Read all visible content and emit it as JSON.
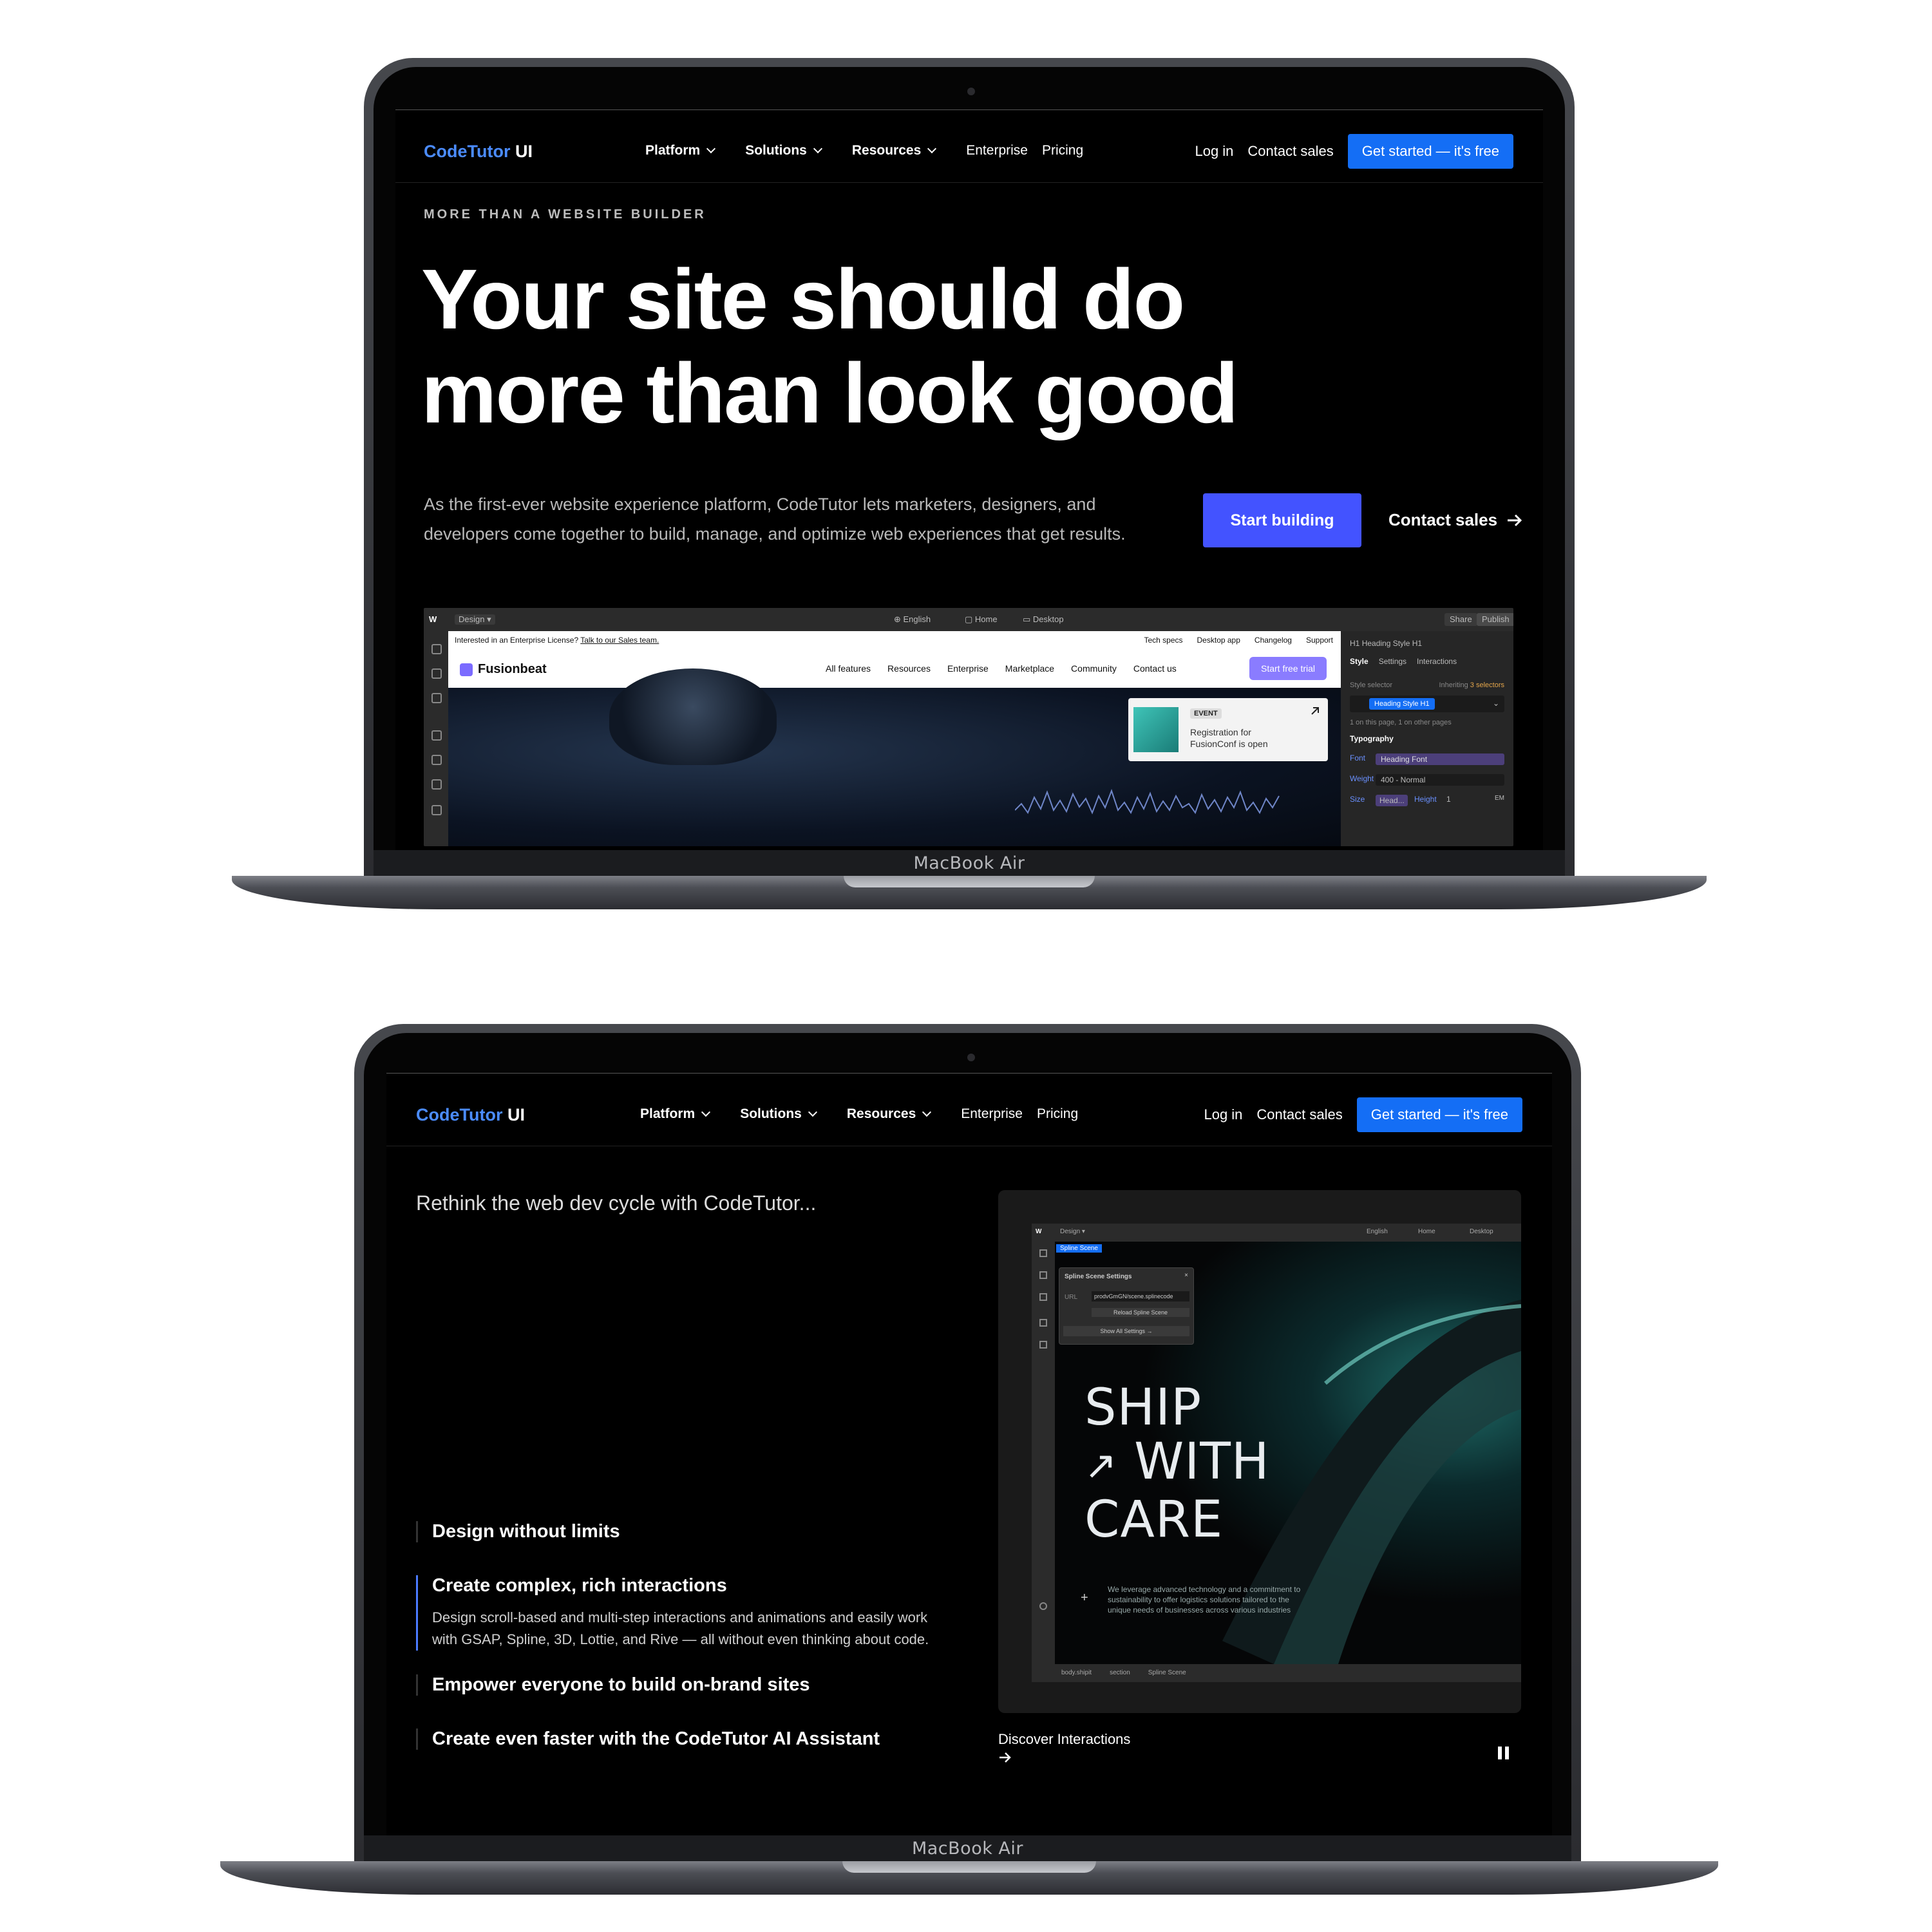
{
  "brand": {
    "name": "CodeTutor",
    "suffix": "UI",
    "accent": "#4b8cff"
  },
  "device_label": "MacBook Air",
  "nav": {
    "items": [
      "Platform",
      "Solutions",
      "Resources",
      "Enterprise",
      "Pricing"
    ],
    "login": "Log in",
    "contact": "Contact sales",
    "cta": "Get started — it's free"
  },
  "hero": {
    "eyebrow": "MORE THAN A WEBSITE BUILDER",
    "title_line1": "Your site should do",
    "title_line2": "more than look good",
    "subtitle": "As the first-ever website experience platform, CodeTutor lets marketers, designers, and developers come together to build, manage, and optimize web experiences that get results.",
    "primary_cta": "Start building",
    "secondary_cta": "Contact sales",
    "primary_color": "#4353ff"
  },
  "designer_top": {
    "mode": "Design",
    "locale": "English",
    "page": "Home",
    "breakpoint": "Desktop",
    "share": "Share",
    "publish": "Publish",
    "banner_text": "Interested in an Enterprise License?",
    "banner_link": "Talk to our Sales team.",
    "banner_links": [
      "Tech specs",
      "Desktop app",
      "Changelog",
      "Support"
    ],
    "site_name": "Fusionbeat",
    "site_nav": [
      "All features",
      "Resources",
      "Enterprise",
      "Marketplace",
      "Community",
      "Contact us"
    ],
    "site_cta": "Start free trial",
    "event_tag": "EVENT",
    "event_text": "Registration for FusionConf is open",
    "panel": {
      "selected": "Heading Style H1",
      "tabs": [
        "Style",
        "Settings",
        "Interactions"
      ],
      "selector_label": "Style selector",
      "inheriting": "Inheriting",
      "inheriting_count": "3 selectors",
      "selector_value": "Heading Style H1",
      "usage": "1 on this page, 1 on other pages",
      "section": "Typography",
      "font_label": "Font",
      "font_value": "Heading Font",
      "weight_label": "Weight",
      "weight_value": "400 - Normal",
      "size_label": "Size",
      "size_value": "Head...",
      "height_label": "Height",
      "height_value": "1",
      "height_unit": "EM"
    }
  },
  "bottom": {
    "intro": "Rethink the web dev cycle with CodeTutor...",
    "features": [
      {
        "title": "Design without limits",
        "body": ""
      },
      {
        "title": "Create complex, rich interactions",
        "body": "Design scroll-based and multi-step interactions and animations and easily work with GSAP, Spline, 3D, Lottie, and Rive — all without even thinking about code."
      },
      {
        "title": "Empower everyone to build on-brand sites",
        "body": ""
      },
      {
        "title": "Create even faster with the CodeTutor AI Assistant",
        "body": ""
      }
    ],
    "demo": {
      "mode": "Design",
      "locale": "English",
      "page": "Home",
      "breakpoint": "Desktop",
      "element_tag": "Spline Scene",
      "settings_title": "Spline Scene Settings",
      "url_label": "URL",
      "url_value": "prodvGmGN/scene.splinecode",
      "reload": "Reload Spline Scene",
      "show_all": "Show All Settings",
      "headline_1": "SHIP",
      "headline_2": "WITH",
      "headline_3": "CARE",
      "blurb": "We leverage advanced technology and a commitment to sustainability to offer logistics solutions tailored to the unique needs of businesses across various industries",
      "crumbs": [
        "body.shipit",
        "section",
        "Spline Scene"
      ]
    },
    "discover": "Discover Interactions"
  }
}
